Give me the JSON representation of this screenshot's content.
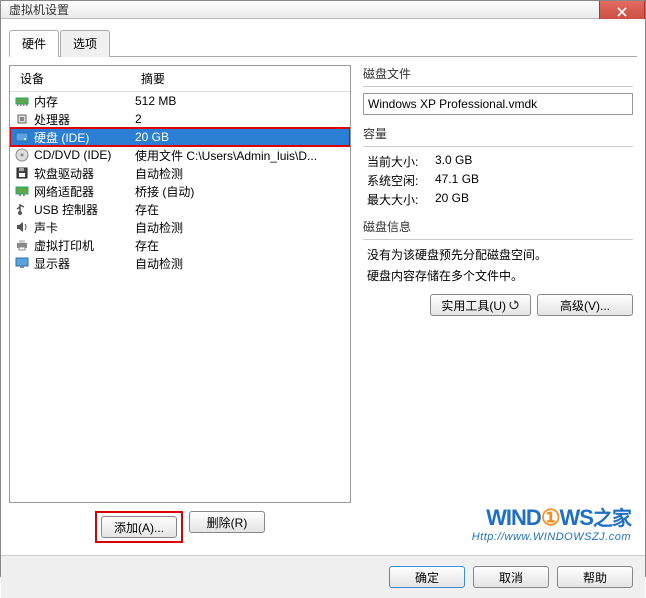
{
  "window": {
    "title": "虚拟机设置"
  },
  "tabs": {
    "hardware": "硬件",
    "options": "选项"
  },
  "list_header": {
    "device": "设备",
    "summary": "摘要"
  },
  "devices": [
    {
      "icon": "memory",
      "name": "内存",
      "summary": "512 MB"
    },
    {
      "icon": "cpu",
      "name": "处理器",
      "summary": "2"
    },
    {
      "icon": "hdd",
      "name": "硬盘 (IDE)",
      "summary": "20 GB",
      "selected": true,
      "highlight": true
    },
    {
      "icon": "disc",
      "name": "CD/DVD (IDE)",
      "summary": "使用文件 C:\\Users\\Admin_luis\\D..."
    },
    {
      "icon": "floppy",
      "name": "软盘驱动器",
      "summary": "自动检测"
    },
    {
      "icon": "nic",
      "name": "网络适配器",
      "summary": "桥接 (自动)"
    },
    {
      "icon": "usb",
      "name": "USB 控制器",
      "summary": "存在"
    },
    {
      "icon": "sound",
      "name": "声卡",
      "summary": "自动检测"
    },
    {
      "icon": "printer",
      "name": "虚拟打印机",
      "summary": "存在"
    },
    {
      "icon": "display",
      "name": "显示器",
      "summary": "自动检测"
    }
  ],
  "left_buttons": {
    "add": "添加(A)...",
    "remove": "删除(R)"
  },
  "right": {
    "disk_file_title": "磁盘文件",
    "disk_file_value": "Windows XP Professional.vmdk",
    "capacity_title": "容量",
    "current_size_label": "当前大小:",
    "current_size_value": "3.0 GB",
    "free_space_label": "系统空闲:",
    "free_space_value": "47.1 GB",
    "max_size_label": "最大大小:",
    "max_size_value": "20 GB",
    "disk_info_title": "磁盘信息",
    "disk_info_line1": "没有为该硬盘预先分配磁盘空间。",
    "disk_info_line2": "硬盘内容存储在多个文件中。",
    "utilities_btn": "实用工具(U)",
    "advanced_btn": "高级(V)..."
  },
  "logo": {
    "brand1": "WIND",
    "brand2": "WS",
    "suffix": "之家",
    "url": "Http://www.WINDOWSZJ.com"
  },
  "footer": {
    "ok": "确定",
    "cancel": "取消",
    "help": "帮助"
  }
}
